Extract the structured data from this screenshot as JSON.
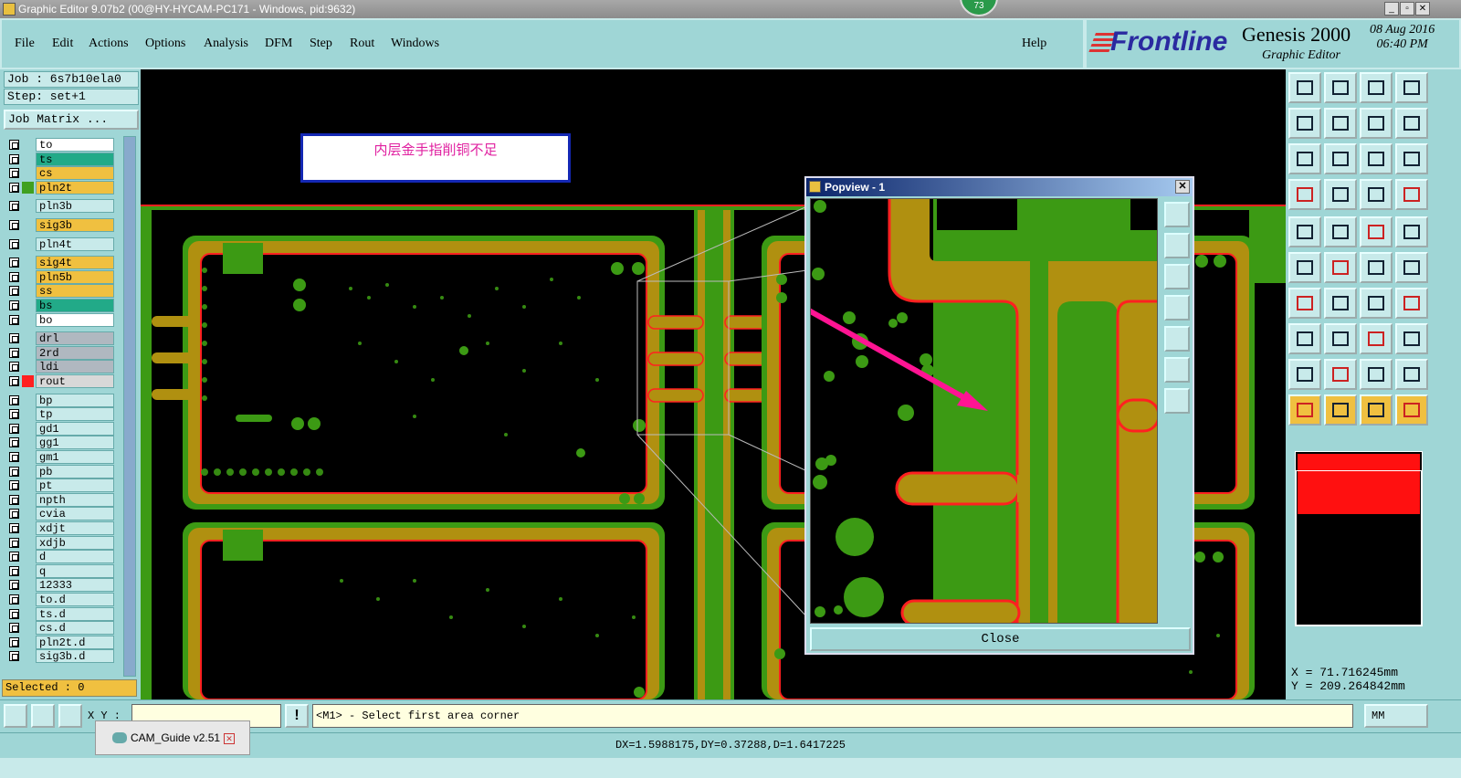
{
  "window": {
    "title": "Graphic Editor 9.07b2 (00@HY-HYCAM-PC171 - Windows, pid:9632)",
    "badge": "73"
  },
  "menu": {
    "items": [
      "File",
      "Edit",
      "Actions",
      "Options",
      "Analysis",
      "DFM",
      "Step",
      "Rout",
      "Windows"
    ],
    "help": "Help"
  },
  "brand": {
    "logo": "Frontline",
    "product": "Genesis 2000",
    "subtitle": "Graphic Editor",
    "date": "08 Aug 2016",
    "time": "06:40 PM"
  },
  "left": {
    "job": "Job : 6s7b10ela0",
    "step": "Step: set+1",
    "job_matrix": "Job Matrix ...",
    "selected": "Selected : 0",
    "layers": [
      {
        "name": "to",
        "color": "#ffffff"
      },
      {
        "name": "ts",
        "color": "#22aa88"
      },
      {
        "name": "cs",
        "color": "#f0c040"
      },
      {
        "name": "pln2t",
        "color": "#f0c040",
        "swatch": "#40a020"
      },
      {
        "name": "pln3b",
        "color": "#c8eaea"
      },
      {
        "name": "sig3b",
        "color": "#f0c040"
      },
      {
        "name": "pln4t",
        "color": "#c8eaea"
      },
      {
        "name": "sig4t",
        "color": "#f0c040"
      },
      {
        "name": "pln5b",
        "color": "#f0c040"
      },
      {
        "name": "ss",
        "color": "#f0c040"
      },
      {
        "name": "bs",
        "color": "#22aa88"
      },
      {
        "name": "bo",
        "color": "#ffffff"
      },
      {
        "name": "drl",
        "color": "#b0b8c0"
      },
      {
        "name": "2rd",
        "color": "#b0b8c0"
      },
      {
        "name": "ldi",
        "color": "#b0b8c0"
      },
      {
        "name": "rout",
        "color": "#d8d8d8",
        "swatch": "#ff2020",
        "active": true
      },
      {
        "name": "bp",
        "color": "#c8eaea"
      },
      {
        "name": "tp",
        "color": "#c8eaea"
      },
      {
        "name": "gd1",
        "color": "#c8eaea"
      },
      {
        "name": "gg1",
        "color": "#c8eaea"
      },
      {
        "name": "gm1",
        "color": "#c8eaea"
      },
      {
        "name": "pb",
        "color": "#c8eaea"
      },
      {
        "name": "pt",
        "color": "#c8eaea"
      },
      {
        "name": "npth",
        "color": "#c8eaea"
      },
      {
        "name": "cvia",
        "color": "#c8eaea"
      },
      {
        "name": "xdjt",
        "color": "#c8eaea"
      },
      {
        "name": "xdjb",
        "color": "#c8eaea"
      },
      {
        "name": "d",
        "color": "#c8eaea"
      },
      {
        "name": "q",
        "color": "#c8eaea"
      },
      {
        "name": "12333",
        "color": "#c8eaea"
      },
      {
        "name": "to.d",
        "color": "#c8eaea"
      },
      {
        "name": "ts.d",
        "color": "#c8eaea"
      },
      {
        "name": "cs.d",
        "color": "#c8eaea"
      },
      {
        "name": "pln2t.d",
        "color": "#c8eaea"
      },
      {
        "name": "sig3b.d",
        "color": "#c8eaea"
      }
    ]
  },
  "canvas": {
    "note": "内层金手指削铜不足"
  },
  "popview": {
    "title": "Popview - 1",
    "close": "Close"
  },
  "coords": {
    "x": "X = 71.716245mm",
    "y": "Y = 209.264842mm"
  },
  "bottom": {
    "xy_label": "X Y :",
    "prompt": "<M1> - Select first area corner",
    "units": "MM"
  },
  "status": {
    "text": "DX=1.5988175,DY=0.37288,D=1.6417225"
  },
  "taskbar": {
    "item": "CAM_Guide v2.51"
  },
  "colors": {
    "copper": "#b09010",
    "green": "#3c9a14",
    "outline": "#ff2020",
    "panel": "#9fd6d6",
    "arrow": "#ff1493"
  }
}
